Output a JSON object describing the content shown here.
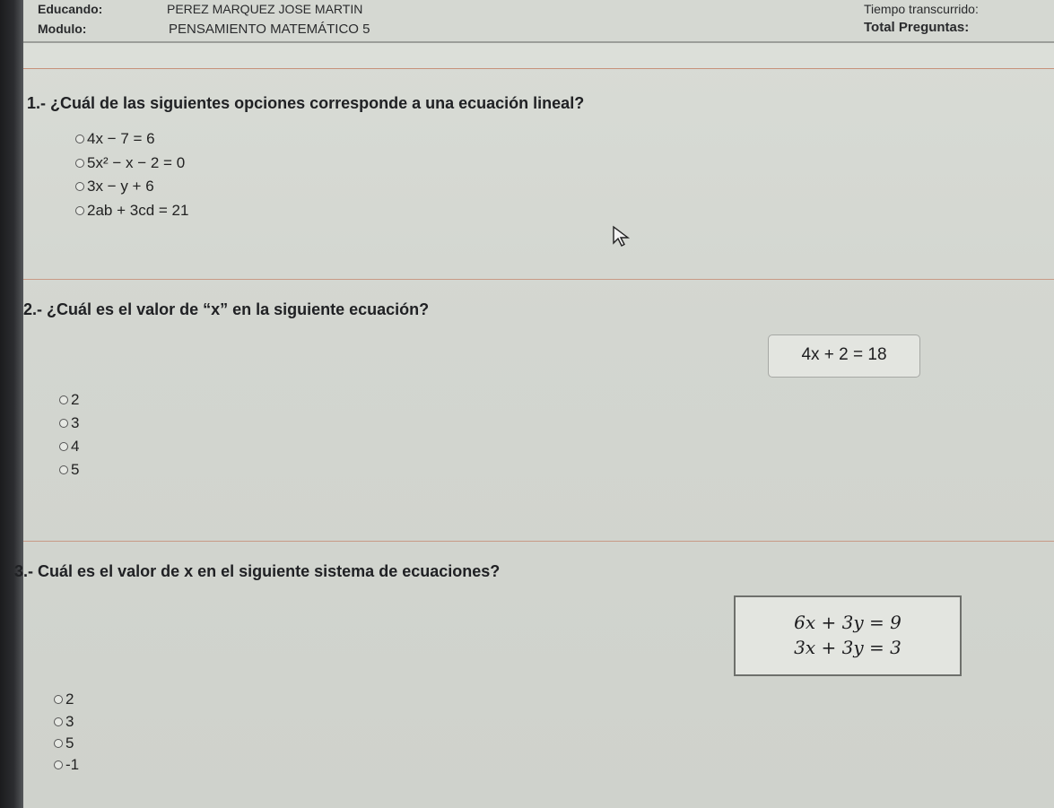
{
  "header": {
    "student_label": "Educando:",
    "student_name": "PEREZ MARQUEZ JOSE MARTIN",
    "module_label": "Modulo:",
    "module_name": "PENSAMIENTO MATEMÁTICO 5",
    "time_label": "Tiempo transcurrido:",
    "total_label": "Total Preguntas:"
  },
  "questions": [
    {
      "number": "1.-",
      "text": "¿Cuál de las siguientes opciones corresponde a una ecuación lineal?",
      "options": [
        "4x − 7 = 6",
        "5x² − x − 2 = 0",
        "3x − y + 6",
        "2ab + 3cd = 21"
      ]
    },
    {
      "number": "2.-",
      "text": "¿Cuál es el valor de “x” en la siguiente ecuación?",
      "equation": "4x + 2 = 18",
      "options": [
        "2",
        "3",
        "4",
        "5"
      ]
    },
    {
      "number": "3.-",
      "text": "Cuál es el valor de x en el siguiente sistema de ecuaciones?",
      "equations": [
        "6x + 3y = 9",
        "3x + 3y = 3"
      ],
      "options": [
        "2",
        "3",
        "5",
        "-1"
      ]
    }
  ]
}
